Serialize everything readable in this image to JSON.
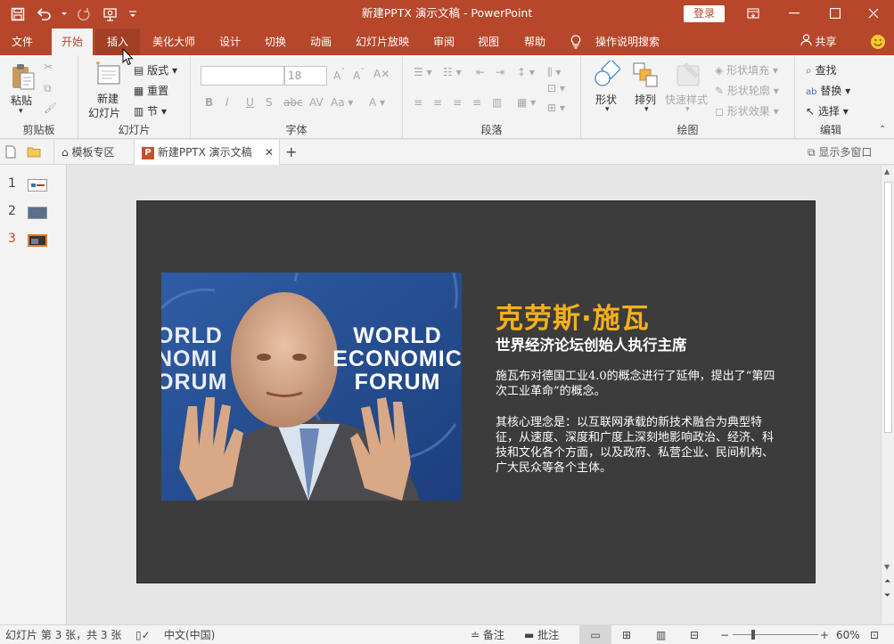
{
  "window": {
    "title": "新建PPTX 演示文稿 - PowerPoint",
    "login_label": "登录"
  },
  "ribbon_tabs": [
    "文件",
    "开始",
    "插入",
    "美化大师",
    "设计",
    "切换",
    "动画",
    "幻灯片放映",
    "审阅",
    "视图",
    "帮助",
    "操作说明搜索"
  ],
  "share_label": "共享",
  "ribbon": {
    "clipboard": {
      "label": "剪贴板",
      "paste": "粘贴"
    },
    "slides": {
      "label": "幻灯片",
      "new_slide_1": "新建",
      "new_slide_2": "幻灯片",
      "layout": "版式",
      "reset": "重置",
      "section": "节"
    },
    "font": {
      "label": "字体",
      "font_name": "",
      "font_size": "18"
    },
    "paragraph": {
      "label": "段落"
    },
    "drawing": {
      "label": "绘图",
      "shapes": "形状",
      "arrange": "排列",
      "quick_styles": "快速样式",
      "fill": "形状填充",
      "outline": "形状轮廓",
      "effects": "形状效果"
    },
    "editing": {
      "label": "编辑",
      "find": "查找",
      "replace": "替换",
      "select": "选择"
    }
  },
  "doc_tabs": {
    "templates": "模板专区",
    "current": "新建PPTX 演示文稿",
    "multi_window": "显示多窗口"
  },
  "thumbnails": [
    "1",
    "2",
    "3"
  ],
  "slide": {
    "title": "克劳斯·施瓦",
    "subtitle": "世界经济论坛创始人执行主席",
    "para1": "施瓦布对德国工业4.0的概念进行了延伸，提出了“第四次工业革命”的概念。",
    "para2": "其核心理念是：以互联网承载的新技术融合为典型特征，从速度、深度和广度上深刻地影响政治、经济、科技和文化各个方面，以及政府、私营企业、民间机构、广大民众等各个主体。",
    "photo_banner": [
      "WORLD",
      "ECONOMIC",
      "FORUM"
    ],
    "photo_banner_left": [
      "ORLD",
      "NOMI",
      "ORUM"
    ]
  },
  "status": {
    "slide_info": "幻灯片 第 3 张，共 3 张",
    "language": "中文(中国)",
    "notes": "备注",
    "comments": "批注",
    "zoom": "60%"
  },
  "colors": {
    "brand": "#b7472a",
    "accent_title": "#f5b01b",
    "slide_bg": "#3c3c3c"
  }
}
